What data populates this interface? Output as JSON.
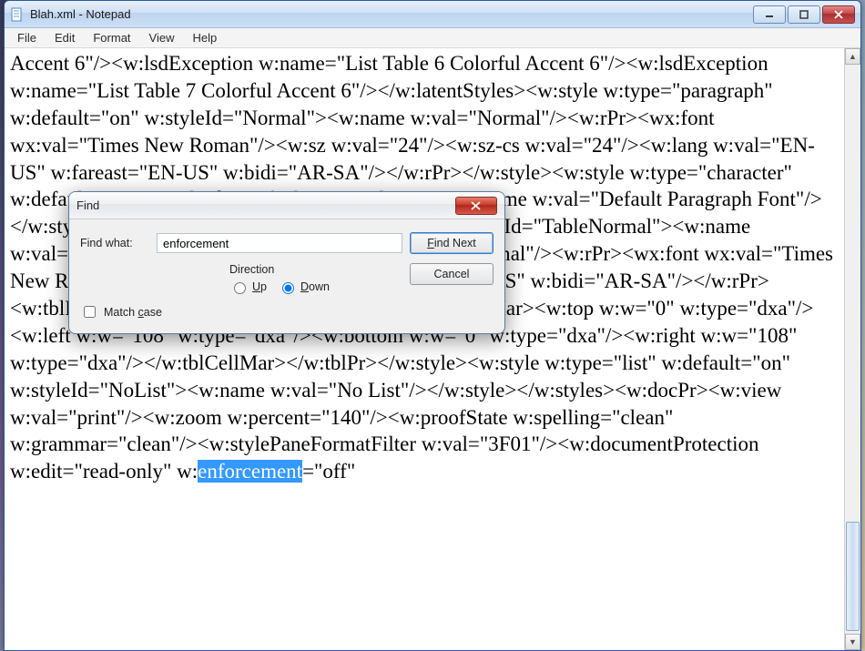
{
  "window": {
    "title": "Blah.xml - Notepad"
  },
  "menu": {
    "file": "File",
    "edit": "Edit",
    "format": "Format",
    "view": "View",
    "help": "Help"
  },
  "editor": {
    "pre_text": "Accent 6\"/><w:lsdException w:name=\"List Table 6 Colorful Accent 6\"/><w:lsdException w:name=\"List Table 7 Colorful Accent 6\"/></w:latentStyles><w:style w:type=\"paragraph\" w:default=\"on\" w:styleId=\"Normal\"><w:name w:val=\"Normal\"/><w:rPr><wx:font wx:val=\"Times New Roman\"/><w:sz w:val=\"24\"/><w:sz-cs w:val=\"24\"/><w:lang w:val=\"EN-US\" w:fareast=\"EN-US\" w:bidi=\"AR-SA\"/></w:rPr></w:style><w:style w:type=\"character\" w:default=\"on\" w:styleId=\"DefaultParagraphFont\"><w:name w:val=\"Default Paragraph Font\"/></w:style><w:style w:type=\"table\" w:default=\"on\" w:styleId=\"TableNormal\"><w:name w:val=\"Normal Table\"/><wx:uiName wx:val=\"Table Normal\"/><w:rPr><wx:font wx:val=\"Times New Roman\"/><w:lang w:val=\"EN-US\" w:fareast=\"EN-US\" w:bidi=\"AR-SA\"/></w:rPr><w:tblPr><w:tblInd w:w=\"0\" w:type=\"dxa\"/><w:tblCellMar><w:top w:w=\"0\" w:type=\"dxa\"/><w:left w:w=\"108\" w:type=\"dxa\"/><w:bottom w:w=\"0\" w:type=\"dxa\"/><w:right w:w=\"108\" w:type=\"dxa\"/></w:tblCellMar></w:tblPr></w:style><w:style w:type=\"list\" w:default=\"on\" w:styleId=\"NoList\"><w:name w:val=\"No List\"/></w:style></w:styles><w:docPr><w:view w:val=\"print\"/><w:zoom w:percent=\"140\"/><w:proofState w:spelling=\"clean\" w:grammar=\"clean\"/><w:stylePaneFormatFilter w:val=\"3F01\"/><w:documentProtection w:edit=\"read-only\" w:",
    "highlight": "enforcement",
    "post_text": "=\"off\""
  },
  "dialog": {
    "title": "Find",
    "find_what_label": "Find what:",
    "find_what_value": "enforcement",
    "find_next_label": "Find Next",
    "cancel_label": "Cancel",
    "direction_label": "Direction",
    "up_label": "Up",
    "down_label": "Down",
    "match_case_label": "Match case",
    "direction_selected": "down",
    "match_case_checked": false
  }
}
